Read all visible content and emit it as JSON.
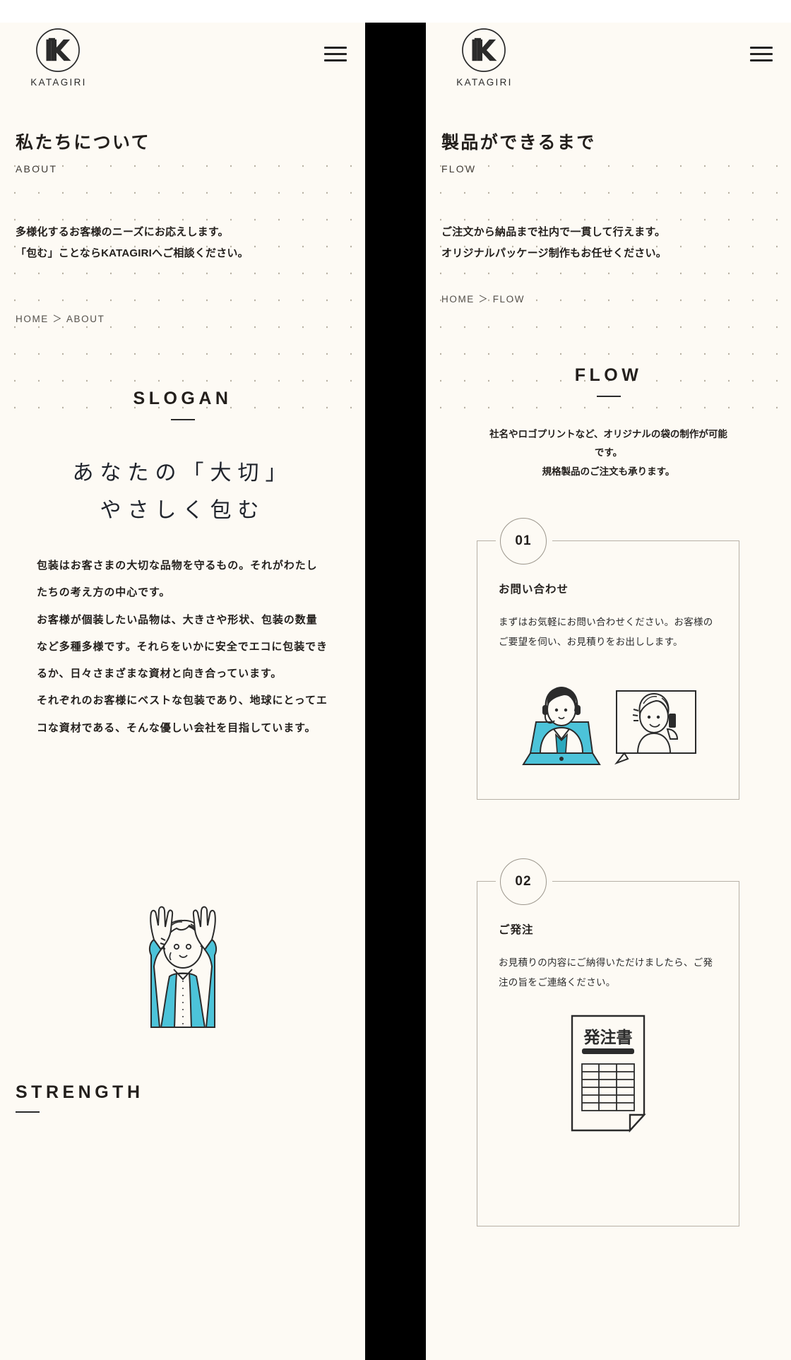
{
  "brand": {
    "name": "KATAGIRI",
    "logo_icon": "katagiri-k-logo",
    "menu_icon": "hamburger-menu-icon"
  },
  "theme": {
    "page_bg": "#fdfaf4",
    "gutter": "#000000",
    "text": "#231f1c",
    "muted": "#54504a",
    "rule": "#b6b0a6",
    "accent_cyan": "#4cc3d9"
  },
  "left_panel": {
    "hero": {
      "title_ja": "私たちについて",
      "title_en": "ABOUT",
      "lead_lines": [
        "多様化するお客様のニーズにお応えします。",
        "「包む」ことならKATAGIRIへご相談ください。"
      ],
      "breadcrumb": "HOME ＞ ABOUT"
    },
    "slogan_section": {
      "heading_en": "SLOGAN",
      "slogan_lines": [
        "あなたの「大切」",
        "やさしく包む"
      ],
      "body_paragraphs": [
        "包装はお客さまの大切な品物を守るもの。それがわたしたちの考え方の中心です。",
        "お客様が個装したい品物は、大きさや形状、包装の数量など多種多様です。それらをいかに安全でエコに包装できるか、日々さまざまな資材と向き合っています。",
        "それぞれのお客様にベストな包装であり、地球にとってエコな資材である、そんな優しい会社を目指しています。"
      ],
      "illustration": "person-cheering-illustration"
    },
    "strength_section": {
      "heading_en": "STRENGTH"
    }
  },
  "right_panel": {
    "hero": {
      "title_ja": "製品ができるまで",
      "title_en": "FLOW",
      "lead_lines": [
        "ご注文から納品まで社内で一貫して行えます。",
        "オリジナルパッケージ制作もお任せください。"
      ],
      "breadcrumb": "HOME ＞ FLOW"
    },
    "flow_section": {
      "heading_en": "FLOW",
      "intro_lines": [
        "社名やロゴプリントなど、オリジナルの袋の制作が可能",
        "です。",
        "規格製品のご注文も承ります。"
      ],
      "steps": [
        {
          "number": "01",
          "title": "お問い合わせ",
          "text": "まずはお気軽にお問い合わせください。お客様のご要望を伺い、お見積りをお出しします。",
          "illustration": "operator-and-caller-illustration"
        },
        {
          "number": "02",
          "title": "ご発注",
          "text": "お見積りの内容にご納得いただけましたら、ご発注の旨をご連絡ください。",
          "illustration": "purchase-order-form-illustration",
          "illustration_label": "発注書"
        }
      ]
    }
  }
}
